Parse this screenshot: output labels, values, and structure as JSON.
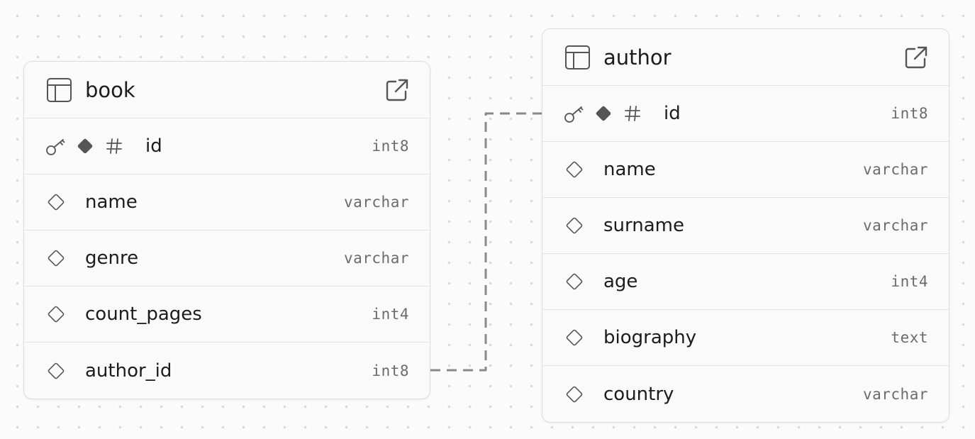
{
  "colors": {
    "background": "#fbfbfb",
    "dot_grid": "#d9d9d9",
    "card_background": "#fafafa",
    "card_border": "#dedede",
    "text": "#1c1c1c",
    "type_text": "#6b6b6b",
    "icon": "#555555",
    "relation_line": "#8a8a8a"
  },
  "icons": {
    "table": "table-icon",
    "open": "external-link-icon",
    "primary_key": "key-icon",
    "identity": "filled-diamond-icon",
    "numeric": "hash-icon",
    "nullable": "hollow-diamond-icon"
  },
  "tables": {
    "book": {
      "name": "book",
      "columns": [
        {
          "name": "id",
          "type": "int8",
          "primary_key": true
        },
        {
          "name": "name",
          "type": "varchar"
        },
        {
          "name": "genre",
          "type": "varchar"
        },
        {
          "name": "count_pages",
          "type": "int4"
        },
        {
          "name": "author_id",
          "type": "int8"
        }
      ]
    },
    "author": {
      "name": "author",
      "columns": [
        {
          "name": "id",
          "type": "int8",
          "primary_key": true
        },
        {
          "name": "name",
          "type": "varchar"
        },
        {
          "name": "surname",
          "type": "varchar"
        },
        {
          "name": "age",
          "type": "int4"
        },
        {
          "name": "biography",
          "type": "text"
        },
        {
          "name": "country",
          "type": "varchar"
        }
      ]
    }
  },
  "relations": [
    {
      "from": "book.author_id",
      "to": "author.id",
      "style": "dashed"
    }
  ]
}
